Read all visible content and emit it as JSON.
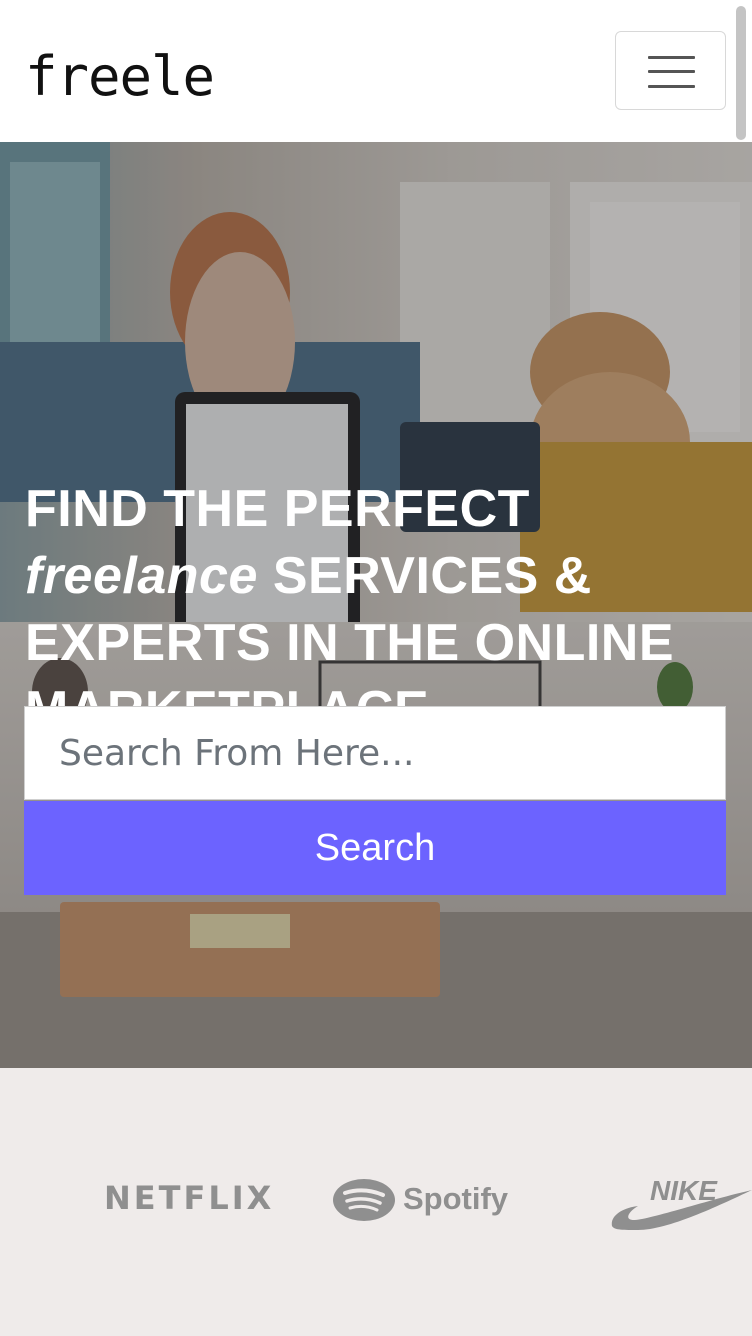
{
  "navbar": {
    "brand": "freele",
    "menu_icon": "hamburger-menu-icon"
  },
  "hero": {
    "headline_part1": "FIND THE PERFECT ",
    "headline_italic": "freelance",
    "headline_part2": " SERVICES & EXPERTS IN THE ONLINE MARKETPLACE",
    "search": {
      "placeholder": "Search From Here...",
      "value": "",
      "button_label": "Search"
    },
    "background_image": "office-coworkers-photo"
  },
  "brands": {
    "items": [
      {
        "name": "NETFLIX",
        "icon": "netflix-logo"
      },
      {
        "name": "Spotify",
        "icon": "spotify-logo"
      },
      {
        "name": "NIKE",
        "icon": "nike-logo"
      }
    ]
  },
  "colors": {
    "accent": "#6c63ff",
    "brand_text": "#111111",
    "logos_gray": "#8f8f8f",
    "brands_bg": "#efebea"
  }
}
